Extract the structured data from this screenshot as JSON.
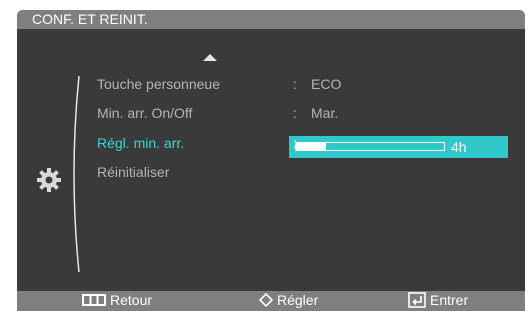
{
  "title": "CONF. ET REINIT.",
  "menu": [
    {
      "label": "Touche personneue",
      "value": "ECO",
      "active": false
    },
    {
      "label": "Min. arr. On/Off",
      "value": "Mar.",
      "active": false
    },
    {
      "label": "Régl. min. arr.",
      "value_text": "4h",
      "progress": 0.2,
      "active": true
    },
    {
      "label": "Réinitialiser",
      "active": false
    }
  ],
  "footer": {
    "back": {
      "label": "Retour",
      "icon": "menu-icon"
    },
    "adjust": {
      "label": "Régler",
      "icon": "diamond-icon"
    },
    "enter": {
      "label": "Entrer",
      "icon": "enter-icon"
    }
  },
  "colors": {
    "accent": "#30c9c9",
    "active_text": "#39d6d6",
    "panel": "#3a3a3a",
    "bars": "#7f7f7f"
  },
  "icons": [
    "up-arrow-icon",
    "gear-icon",
    "bracket-icon"
  ]
}
